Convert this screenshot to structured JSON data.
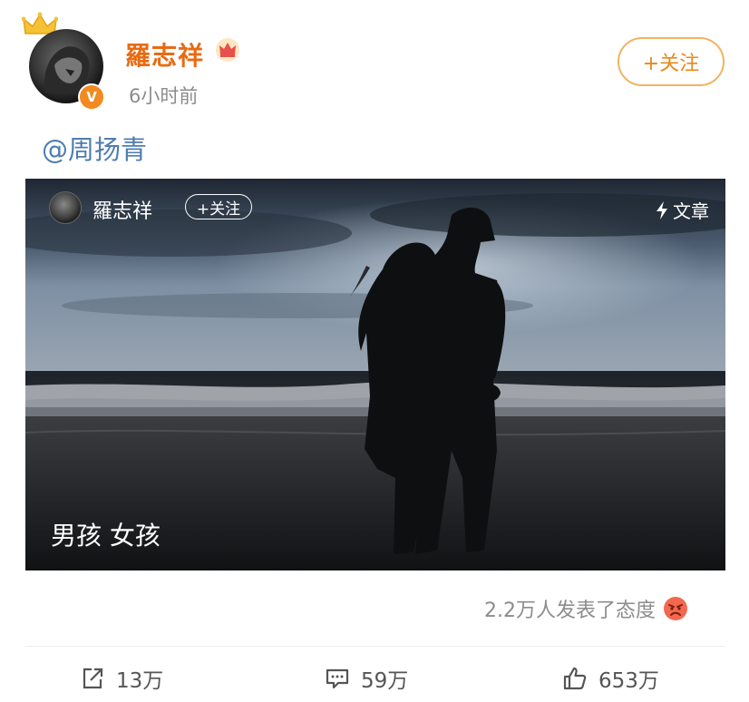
{
  "post": {
    "username": "羅志祥",
    "timestamp": "6小时前",
    "follow_label": "+关注",
    "mention": "@周扬青",
    "verified_badge": "V"
  },
  "card": {
    "username": "羅志祥",
    "follow_label": "+关注",
    "article_label": "文章",
    "title": "男孩 女孩"
  },
  "reactions": {
    "text": "2.2万人发表了态度"
  },
  "actions": {
    "share_count": "13万",
    "comment_count": "59万",
    "like_count": "653万"
  },
  "colors": {
    "username": "#e86b13",
    "mention": "#4f7db0",
    "follow_border": "#f0b462",
    "follow_text": "#e8881a",
    "muted": "#8c8c8c"
  },
  "icons": [
    "crown-icon",
    "vip-crown-icon",
    "verified-badge-icon",
    "lightning-icon",
    "angry-face-icon",
    "share-icon",
    "comment-icon",
    "like-icon"
  ]
}
